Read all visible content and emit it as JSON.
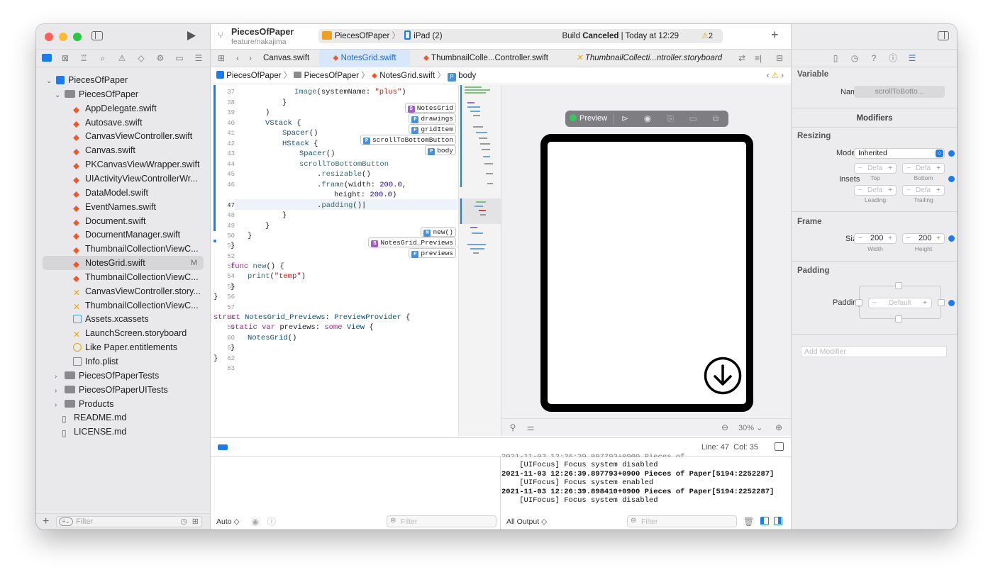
{
  "sidebar": {
    "filter_placeholder": "Filter",
    "tree": [
      {
        "label": "PiecesOfPaper",
        "kind": "project"
      },
      {
        "label": "PiecesOfPaper",
        "kind": "folder"
      },
      {
        "label": "AppDelegate.swift",
        "kind": "swift"
      },
      {
        "label": "Autosave.swift",
        "kind": "swift"
      },
      {
        "label": "CanvasViewController.swift",
        "kind": "swift"
      },
      {
        "label": "Canvas.swift",
        "kind": "swift"
      },
      {
        "label": "PKCanvasViewWrapper.swift",
        "kind": "swift"
      },
      {
        "label": "UIActivityViewControllerWr...",
        "kind": "swift"
      },
      {
        "label": "DataModel.swift",
        "kind": "swift"
      },
      {
        "label": "EventNames.swift",
        "kind": "swift"
      },
      {
        "label": "Document.swift",
        "kind": "swift"
      },
      {
        "label": "DocumentManager.swift",
        "kind": "swift"
      },
      {
        "label": "ThumbnailCollectionViewC...",
        "kind": "swift"
      },
      {
        "label": "NotesGrid.swift",
        "kind": "swift",
        "badge": "M",
        "selected": true
      },
      {
        "label": "ThumbnailCollectionViewC...",
        "kind": "swift"
      },
      {
        "label": "CanvasViewController.story...",
        "kind": "storyboard"
      },
      {
        "label": "ThumbnailCollectionViewC...",
        "kind": "storyboard"
      },
      {
        "label": "Assets.xcassets",
        "kind": "assets"
      },
      {
        "label": "LaunchScreen.storyboard",
        "kind": "storyboard"
      },
      {
        "label": "Like Paper.entitlements",
        "kind": "entitlements"
      },
      {
        "label": "Info.plist",
        "kind": "plist"
      },
      {
        "label": "PiecesOfPaperTests",
        "kind": "folder"
      },
      {
        "label": "PiecesOfPaperUITests",
        "kind": "folder"
      },
      {
        "label": "Products",
        "kind": "folder"
      },
      {
        "label": "README.md",
        "kind": "doc"
      },
      {
        "label": "LICENSE.md",
        "kind": "doc"
      }
    ]
  },
  "toolbar": {
    "project": "PiecesOfPaper",
    "branch": "feature/nakajima",
    "scheme": "PiecesOfPaper",
    "device": "iPad (2)",
    "status_prefix": "Build",
    "status_bold": "Canceled",
    "status_time": "| Today at 12:29",
    "warning_count": "2"
  },
  "tabs": [
    "Canvas.swift",
    "NotesGrid.swift",
    "ThumbnailColle...Controller.swift",
    "ThumbnailCollecti...ntroller.storyboard"
  ],
  "breadcrumb": [
    "PiecesOfPaper",
    "PiecesOfPaper",
    "NotesGrid.swift",
    "body"
  ],
  "code": {
    "line_numbers": [
      "37",
      "38",
      "39",
      "40",
      "41",
      "42",
      "43",
      "44",
      "45",
      "46",
      "",
      "47",
      "48",
      "49",
      "50",
      "51",
      "52",
      "53",
      "54",
      "55",
      "56",
      "57",
      "58",
      "59",
      "60",
      "61",
      "62",
      "63"
    ],
    "tags": [
      {
        "badge": "S",
        "label": "NotesGrid"
      },
      {
        "badge": "P",
        "label": "drawings"
      },
      {
        "badge": "P",
        "label": "gridItem"
      },
      {
        "badge": "P",
        "label": "scrollToBottomButton"
      },
      {
        "badge": "P",
        "label": "body"
      },
      {
        "badge": "M",
        "label": "new()"
      },
      {
        "badge": "S",
        "label": "NotesGrid_Previews"
      },
      {
        "badge": "P",
        "label": "previews"
      }
    ]
  },
  "preview": {
    "label": "Preview",
    "zoom": "30%"
  },
  "statusbar": {
    "position": "Line: 47  Col: 35"
  },
  "console": {
    "lines": [
      "    [UIFocus] Focus system disabled",
      "2021-11-03 12:26:39.897793+0900 Pieces of Paper[5194:2252287]",
      "    [UIFocus] Focus system enabled",
      "2021-11-03 12:26:39.898410+0900 Pieces of Paper[5194:2252287]",
      "    [UIFocus] Focus system disabled"
    ],
    "auto_label": "Auto ◇",
    "filter_placeholder": "Filter",
    "output_label": "All Output ◇",
    "output_filter_placeholder": "Filter"
  },
  "inspector": {
    "variable_section": "Variable",
    "name_label": "Name",
    "name_value": "scrollToBotto...",
    "modifiers_title": "Modifiers",
    "resizing_section": "Resizing",
    "mode_label": "Mode",
    "mode_value": "Inherited",
    "insets_label": "Insets",
    "inset_placeholder": "Defa",
    "top_label": "Top",
    "bottom_label": "Bottom",
    "leading_label": "Leading",
    "trailing_label": "Trailing",
    "frame_section": "Frame",
    "size_label": "Size",
    "width_value": "200",
    "height_value": "200",
    "width_label": "Width",
    "height_label": "Height",
    "padding_section": "Padding",
    "padding_label": "Padding",
    "padding_default": "Default",
    "add_modifier_placeholder": "Add Modifier"
  },
  "colors": {
    "accent": "#1a7cf4",
    "swift": "#f0582a",
    "storyboard": "#f2a600",
    "selection": "#d6d5d8"
  }
}
